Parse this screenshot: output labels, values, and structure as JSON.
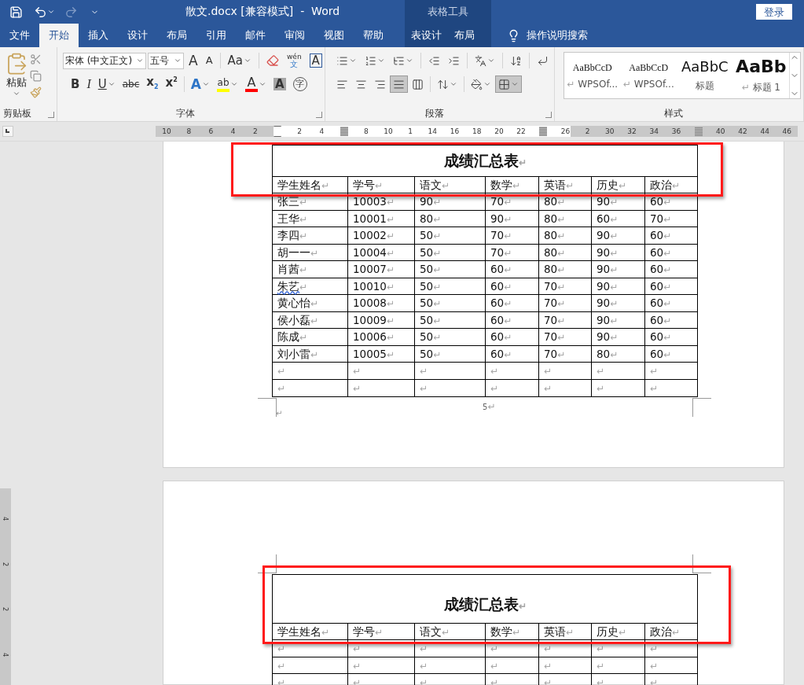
{
  "title_bar": {
    "title": "散文.docx [兼容模式]  -  Word",
    "context_group": "表格工具",
    "login": "登录"
  },
  "tabs": [
    {
      "label": "文件",
      "selected": false,
      "context": false
    },
    {
      "label": "开始",
      "selected": true,
      "context": false
    },
    {
      "label": "插入",
      "selected": false,
      "context": false
    },
    {
      "label": "设计",
      "selected": false,
      "context": false
    },
    {
      "label": "布局",
      "selected": false,
      "context": false
    },
    {
      "label": "引用",
      "selected": false,
      "context": false
    },
    {
      "label": "邮件",
      "selected": false,
      "context": false
    },
    {
      "label": "审阅",
      "selected": false,
      "context": false
    },
    {
      "label": "视图",
      "selected": false,
      "context": false
    },
    {
      "label": "帮助",
      "selected": false,
      "context": false
    },
    {
      "label": "表设计",
      "selected": false,
      "context": true
    },
    {
      "label": "布局",
      "selected": false,
      "context": true
    }
  ],
  "tell_me": "操作说明搜索",
  "ribbon": {
    "clipboard": {
      "paste": "粘贴",
      "group": "剪贴板"
    },
    "font": {
      "group": "字体",
      "name": "宋体 (中文正文)",
      "size": "五号",
      "row1": [
        {
          "kind": "grow",
          "label": "A"
        },
        {
          "kind": "shrink",
          "label": "A"
        },
        {
          "kind": "sep"
        },
        {
          "kind": "case",
          "label": "Aa"
        },
        {
          "kind": "sep"
        },
        {
          "kind": "clear"
        },
        {
          "kind": "phonetic",
          "label": "wén",
          "sub": "文"
        },
        {
          "kind": "boxed",
          "label": "A"
        }
      ],
      "row2": [
        {
          "kind": "bold",
          "label": "B"
        },
        {
          "kind": "italic",
          "label": "I"
        },
        {
          "kind": "underline",
          "label": "U"
        },
        {
          "kind": "strike",
          "label": "abc"
        },
        {
          "kind": "subscript",
          "label": "x",
          "script": "2"
        },
        {
          "kind": "superscript",
          "label": "x",
          "script": "2"
        },
        {
          "kind": "sep"
        },
        {
          "kind": "effect",
          "label": "A"
        },
        {
          "kind": "highlight",
          "label": "ab",
          "color": "#ffff00"
        },
        {
          "kind": "fontcolor",
          "label": "A",
          "color": "#ff0000"
        },
        {
          "kind": "shade",
          "label": "A"
        },
        {
          "kind": "enclose",
          "label": "字"
        }
      ]
    },
    "paragraph": {
      "group": "段落",
      "row1": [
        {
          "kind": "bullets"
        },
        {
          "kind": "numbering"
        },
        {
          "kind": "multilevel"
        },
        {
          "kind": "sep"
        },
        {
          "kind": "outdent"
        },
        {
          "kind": "indent"
        },
        {
          "kind": "sep"
        },
        {
          "kind": "layout"
        },
        {
          "kind": "sep"
        },
        {
          "kind": "sort"
        },
        {
          "kind": "sep"
        },
        {
          "kind": "marks"
        }
      ],
      "row2": [
        {
          "kind": "left",
          "selected": false
        },
        {
          "kind": "center",
          "selected": false
        },
        {
          "kind": "right",
          "selected": false
        },
        {
          "kind": "justify",
          "selected": true
        },
        {
          "kind": "distribute",
          "selected": false
        },
        {
          "kind": "sep"
        },
        {
          "kind": "spacing",
          "selected": false
        },
        {
          "kind": "sep"
        },
        {
          "kind": "shading",
          "selected": false
        },
        {
          "kind": "borders",
          "selected": true
        }
      ]
    },
    "styles": {
      "group": "样式",
      "items": [
        {
          "sample": "AaBbCcD",
          "label": "WPSOf...",
          "mark": "↵",
          "kind": "serif"
        },
        {
          "sample": "AaBbCcD",
          "label": "WPSOf...",
          "mark": "↵",
          "kind": "serif"
        },
        {
          "sample": "AaBbC",
          "label": "标题",
          "kind": "title"
        },
        {
          "sample": "AaBb",
          "label": "标题 1",
          "mark": "↵",
          "kind": "heading"
        }
      ]
    }
  },
  "ruler": [
    {
      "kind": "num",
      "label": "10"
    },
    {
      "kind": "num",
      "label": "8"
    },
    {
      "kind": "num",
      "label": "6"
    },
    {
      "kind": "num",
      "label": "4"
    },
    {
      "kind": "num",
      "label": "2"
    },
    {
      "kind": "indent"
    },
    {
      "kind": "num",
      "label": "2"
    },
    {
      "kind": "num",
      "label": "4"
    },
    {
      "kind": "marker"
    },
    {
      "kind": "num",
      "label": "8"
    },
    {
      "kind": "num",
      "label": "10"
    },
    {
      "kind": "num",
      "label": "1"
    },
    {
      "kind": "num",
      "label": "14"
    },
    {
      "kind": "num",
      "label": "16"
    },
    {
      "kind": "num",
      "label": "18"
    },
    {
      "kind": "num",
      "label": "20"
    },
    {
      "kind": "num",
      "label": "22"
    },
    {
      "kind": "marker"
    },
    {
      "kind": "num",
      "label": "26"
    },
    {
      "kind": "num",
      "label": "2"
    },
    {
      "kind": "num",
      "label": "30"
    },
    {
      "kind": "num",
      "label": "32"
    },
    {
      "kind": "num",
      "label": "34"
    },
    {
      "kind": "num",
      "label": "36"
    },
    {
      "kind": "marker"
    },
    {
      "kind": "num",
      "label": "40"
    },
    {
      "kind": "num",
      "label": "42"
    },
    {
      "kind": "num",
      "label": "44"
    },
    {
      "kind": "num",
      "label": "46"
    }
  ],
  "vertical_ruler": [
    "4",
    "2",
    "2",
    "4"
  ],
  "pages": [
    {
      "highlighted": true,
      "tall_title": false,
      "page_number": "5",
      "page_number_mark": "↵",
      "after_mark": "↵",
      "table": {
        "title": "成绩汇总表",
        "title_mark": "↵",
        "header": [
          {
            "t": "学生姓名",
            "m": "↵"
          },
          {
            "t": "学号",
            "m": "↵"
          },
          {
            "t": "语文",
            "m": "↵"
          },
          {
            "t": "数学",
            "m": "↵"
          },
          {
            "t": "英语",
            "m": "↵"
          },
          {
            "t": "历史",
            "m": "↵"
          },
          {
            "t": "政治",
            "m": "↵"
          }
        ],
        "rows": [
          [
            {
              "t": "张三",
              "m": "↵"
            },
            {
              "t": "10003",
              "m": "↵"
            },
            {
              "t": "90",
              "m": "↵"
            },
            {
              "t": "70",
              "m": "↵"
            },
            {
              "t": "80",
              "m": "↵"
            },
            {
              "t": "90",
              "m": "↵"
            },
            {
              "t": "60",
              "m": "↵"
            }
          ],
          [
            {
              "t": "王华",
              "m": "↵"
            },
            {
              "t": "10001",
              "m": "↵"
            },
            {
              "t": "80",
              "m": "↵"
            },
            {
              "t": "90",
              "m": "↵"
            },
            {
              "t": "80",
              "m": "↵"
            },
            {
              "t": "60",
              "m": "↵"
            },
            {
              "t": "70",
              "m": "↵"
            }
          ],
          [
            {
              "t": "李四",
              "m": "↵"
            },
            {
              "t": "10002",
              "m": "↵"
            },
            {
              "t": "50",
              "m": "↵"
            },
            {
              "t": "70",
              "m": "↵"
            },
            {
              "t": "80",
              "m": "↵"
            },
            {
              "t": "90",
              "m": "↵"
            },
            {
              "t": "60",
              "m": "↵"
            }
          ],
          [
            {
              "t": "胡一一",
              "m": "↵"
            },
            {
              "t": "10004",
              "m": "↵"
            },
            {
              "t": "50",
              "m": "↵"
            },
            {
              "t": "70",
              "m": "↵"
            },
            {
              "t": "80",
              "m": "↵"
            },
            {
              "t": "90",
              "m": "↵"
            },
            {
              "t": "60",
              "m": "↵"
            }
          ],
          [
            {
              "t": "肖茜",
              "m": "↵"
            },
            {
              "t": "10007",
              "m": "↵"
            },
            {
              "t": "50",
              "m": "↵"
            },
            {
              "t": "60",
              "m": "↵"
            },
            {
              "t": "80",
              "m": "↵"
            },
            {
              "t": "90",
              "m": "↵"
            },
            {
              "t": "60",
              "m": "↵"
            }
          ],
          [
            {
              "t": "朱艺",
              "m": "↵",
              "spell": true
            },
            {
              "t": "10010",
              "m": "↵"
            },
            {
              "t": "50",
              "m": "↵"
            },
            {
              "t": "60",
              "m": "↵"
            },
            {
              "t": "70",
              "m": "↵"
            },
            {
              "t": "90",
              "m": "↵"
            },
            {
              "t": "60",
              "m": "↵"
            }
          ],
          [
            {
              "t": "黄心怡",
              "m": "↵"
            },
            {
              "t": "10008",
              "m": "↵"
            },
            {
              "t": "50",
              "m": "↵"
            },
            {
              "t": "60",
              "m": "↵"
            },
            {
              "t": "70",
              "m": "↵"
            },
            {
              "t": "90",
              "m": "↵"
            },
            {
              "t": "60",
              "m": "↵"
            }
          ],
          [
            {
              "t": "侯小磊",
              "m": "↵"
            },
            {
              "t": "10009",
              "m": "↵"
            },
            {
              "t": "50",
              "m": "↵"
            },
            {
              "t": "60",
              "m": "↵"
            },
            {
              "t": "70",
              "m": "↵"
            },
            {
              "t": "90",
              "m": "↵"
            },
            {
              "t": "60",
              "m": "↵"
            }
          ],
          [
            {
              "t": "陈成",
              "m": "↵"
            },
            {
              "t": "10006",
              "m": "↵"
            },
            {
              "t": "50",
              "m": "↵"
            },
            {
              "t": "60",
              "m": "↵"
            },
            {
              "t": "70",
              "m": "↵"
            },
            {
              "t": "90",
              "m": "↵"
            },
            {
              "t": "60",
              "m": "↵"
            }
          ],
          [
            {
              "t": "刘小雷",
              "m": "↵"
            },
            {
              "t": "10005",
              "m": "↵"
            },
            {
              "t": "50",
              "m": "↵"
            },
            {
              "t": "60",
              "m": "↵"
            },
            {
              "t": "70",
              "m": "↵"
            },
            {
              "t": "80",
              "m": "↵"
            },
            {
              "t": "60",
              "m": "↵"
            }
          ],
          [
            {
              "m": "↵"
            },
            {
              "m": "↵"
            },
            {
              "m": "↵"
            },
            {
              "m": "↵"
            },
            {
              "m": "↵"
            },
            {
              "m": "↵"
            },
            {
              "m": "↵"
            }
          ],
          [
            {
              "m": "↵"
            },
            {
              "m": "↵"
            },
            {
              "m": "↵"
            },
            {
              "m": "↵"
            },
            {
              "m": "↵"
            },
            {
              "m": "↵"
            },
            {
              "m": "↵"
            }
          ]
        ]
      }
    },
    {
      "highlighted": true,
      "tall_title": true,
      "table": {
        "title": "成绩汇总表",
        "title_mark": "↵",
        "header": [
          {
            "t": "学生姓名",
            "m": "↵"
          },
          {
            "t": "学号",
            "m": "↵"
          },
          {
            "t": "语文",
            "m": "↵"
          },
          {
            "t": "数学",
            "m": "↵"
          },
          {
            "t": "英语",
            "m": "↵"
          },
          {
            "t": "历史",
            "m": "↵"
          },
          {
            "t": "政治",
            "m": "↵"
          }
        ],
        "rows": [
          [
            {
              "m": "↵"
            },
            {
              "m": "↵"
            },
            {
              "m": "↵"
            },
            {
              "m": "↵"
            },
            {
              "m": "↵"
            },
            {
              "m": "↵"
            },
            {
              "m": "↵"
            }
          ],
          [
            {
              "m": "↵"
            },
            {
              "m": "↵"
            },
            {
              "m": "↵"
            },
            {
              "m": "↵"
            },
            {
              "m": "↵"
            },
            {
              "m": "↵"
            },
            {
              "m": "↵"
            }
          ],
          [
            {
              "m": "↵"
            },
            {
              "m": "↵"
            },
            {
              "m": "↵"
            },
            {
              "m": "↵"
            },
            {
              "m": "↵"
            },
            {
              "m": "↵"
            },
            {
              "m": "↵"
            }
          ]
        ]
      }
    }
  ]
}
